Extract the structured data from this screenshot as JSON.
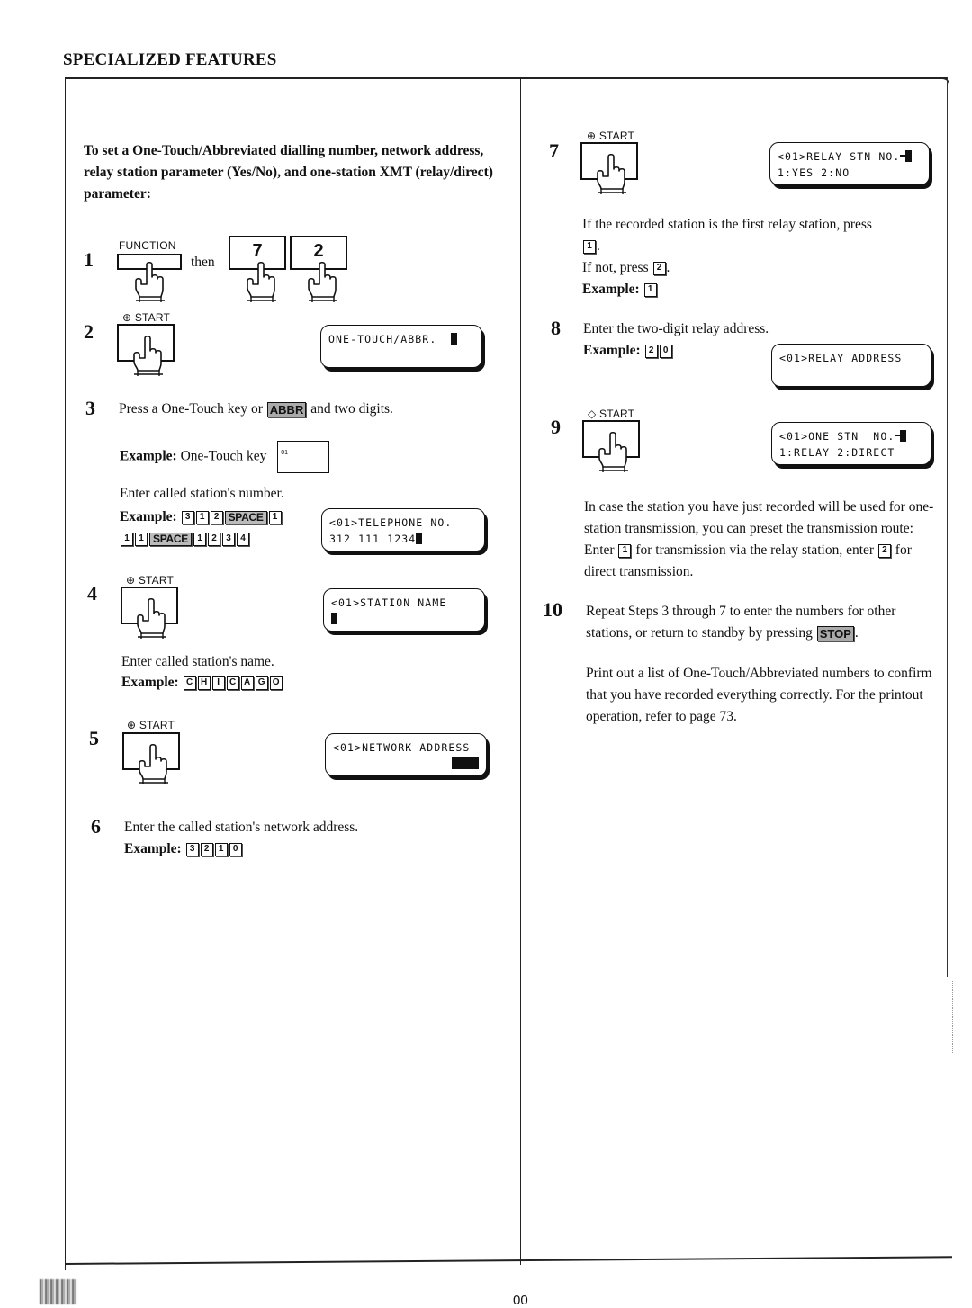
{
  "header": {
    "section_title": "SPECIALIZED FEATURES"
  },
  "intro": "To set a One-Touch/Abbreviated dialling number, network address, relay station parameter (Yes/No), and one-station XMT (relay/direct) parameter:",
  "labels": {
    "function_key": "FUNCTION",
    "start_key": "START",
    "then": "then",
    "example": "Example:"
  },
  "steps": {
    "s1": {
      "num": "1",
      "keys": [
        "7",
        "2"
      ]
    },
    "s2": {
      "num": "2",
      "lcd": [
        "ONE-TOUCH/ABBR.",
        ""
      ]
    },
    "s3": {
      "num": "3",
      "text_before": "Press a One-Touch key or",
      "abbr_key": "ABBR",
      "text_after": "and two digits.",
      "example_onetouch_label": "One-Touch key",
      "onetouch_key_number": "01",
      "enter_number_text": "Enter called station's number.",
      "number_keys_line1": [
        "3",
        "1",
        "2",
        "SPACE",
        "1"
      ],
      "number_keys_line2": [
        "1",
        "1",
        "SPACE",
        "1",
        "2",
        "3",
        "4"
      ],
      "lcd": [
        "<01>TELEPHONE NO.",
        "312 111 1234"
      ]
    },
    "s4": {
      "num": "4",
      "lcd": [
        "<01>STATION NAME",
        ""
      ],
      "enter_name_text": "Enter called station's name.",
      "name_keys": [
        "C",
        "H",
        "I",
        "C",
        "A",
        "G",
        "O"
      ]
    },
    "s5": {
      "num": "5",
      "lcd": [
        "<01>NETWORK ADDRESS",
        ""
      ]
    },
    "s6": {
      "num": "6",
      "text": "Enter the called station's network address.",
      "keys": [
        "3",
        "2",
        "1",
        "0"
      ]
    },
    "s7": {
      "num": "7",
      "lcd": [
        "<01>RELAY STN NO.",
        "1:YES 2:NO"
      ],
      "text_line1": "If the recorded station is the first relay station, press",
      "key_yes": "1",
      "text_not": "If not, press",
      "key_no": "2",
      "example_key": "1"
    },
    "s8": {
      "num": "8",
      "text": "Enter the two-digit relay address.",
      "keys": [
        "2",
        "0"
      ],
      "lcd": [
        "<01>RELAY ADDRESS",
        ""
      ]
    },
    "s9": {
      "num": "9",
      "lcd": [
        "<01>ONE STN  NO.",
        "1:RELAY 2:DIRECT"
      ],
      "text_a": "In case the station you have just recorded will be used for one-station transmission, you can preset the transmission route: Enter",
      "key_relay": "1",
      "text_b": "for transmission via the relay station, enter",
      "key_direct": "2",
      "text_c": "for direct transmission."
    },
    "s10": {
      "num": "10",
      "text": "Repeat Steps 3 through 7 to enter the numbers for other stations, or return to standby by pressing",
      "stop_key": "STOP",
      "note": "Print out a list of One-Touch/Abbreviated numbers to confirm that you have recorded everything correctly. For the printout operation, refer to page 73."
    }
  },
  "footer": {
    "page_number": "00"
  }
}
